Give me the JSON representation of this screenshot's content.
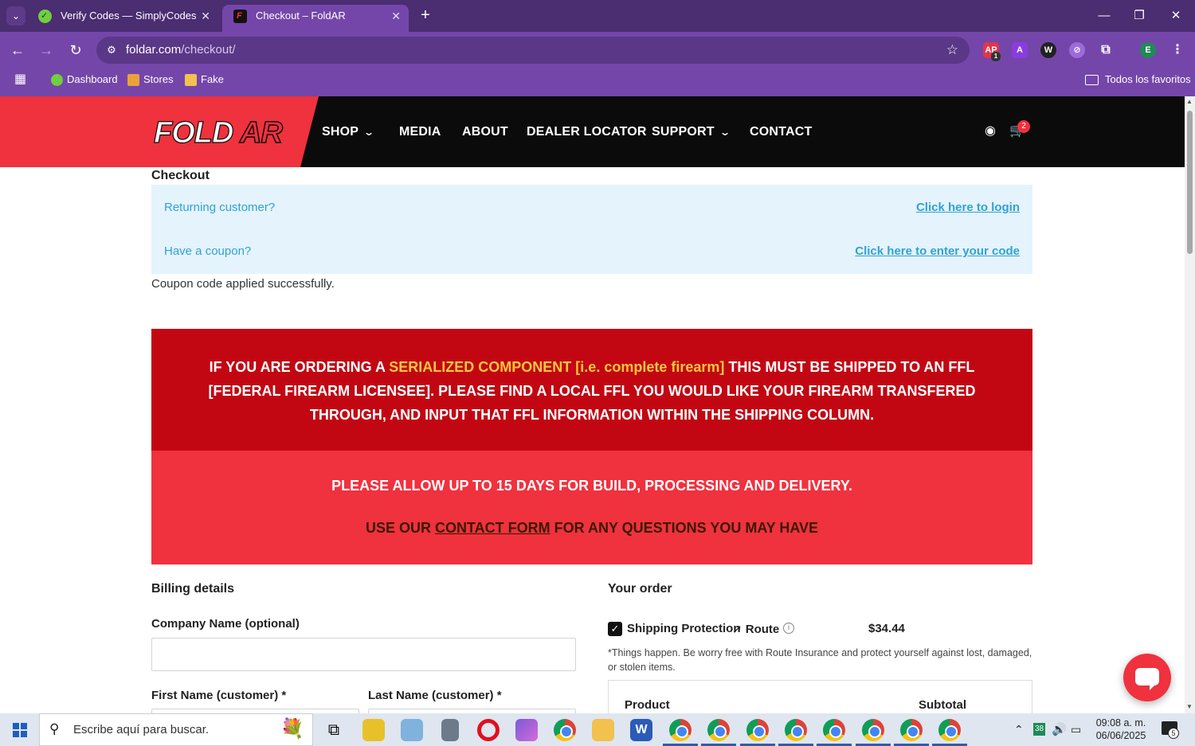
{
  "browser": {
    "tabs": [
      {
        "label": "Verify Codes — SimplyCodes",
        "active": false
      },
      {
        "label": "Checkout – FoldAR",
        "active": true
      }
    ],
    "url_host": "foldar.com",
    "url_path": "/checkout/",
    "bookmarks": [
      "Dashboard",
      "Stores",
      "Fake"
    ],
    "all_favorites": "Todos los favoritos",
    "profile_initial": "E",
    "ext_badge": "1",
    "accent": "#7446aa"
  },
  "site": {
    "logo_text": "FOLDAR",
    "nav": [
      "SHOP",
      "MEDIA",
      "ABOUT",
      "DEALER LOCATOR",
      "SUPPORT",
      "CONTACT"
    ],
    "cart_count": "2",
    "brand_red": "#f0313e",
    "dark_red": "#c20713"
  },
  "checkout": {
    "title": "Checkout",
    "returning": "Returning customer?",
    "login_link": "Click here to login",
    "coupon_q": "Have a coupon?",
    "coupon_link": "Click here to enter your code",
    "coupon_ok": "Coupon code applied successfully."
  },
  "banner": {
    "pre": "IF YOU ARE ORDERING A ",
    "highlight": "SERIALIZED COMPONENT [i.e. complete firearm]",
    "post": " THIS MUST BE SHIPPED TO AN FFL [FEDERAL FIREARM LICENSEE]. PLEASE FIND A LOCAL FFL YOU WOULD LIKE YOUR FIREARM TRANSFERED THROUGH, AND INPUT THAT FFL INFORMATION WITHIN THE SHIPPING COLUMN.",
    "allow": "PLEASE ALLOW UP TO 15 DAYS FOR BUILD, PROCESSING AND DELIVERY.",
    "use_pre": "USE OUR ",
    "use_link": "CONTACT FORM",
    "use_post": " FOR ANY QUESTIONS YOU MAY HAVE"
  },
  "billing": {
    "heading": "Billing details",
    "company_label": "Company Name (optional)",
    "company_value": "",
    "first_label": "First Name (customer) *",
    "last_label": "Last Name (customer) *"
  },
  "order": {
    "heading": "Your order",
    "shipping_label": "Shipping Protection",
    "route_label": "Route",
    "shipping_price": "$34.44",
    "shipping_checked": true,
    "route_note": "*Things happen. Be worry free with Route Insurance and protect yourself against lost, damaged, or stolen items.",
    "col_product": "Product",
    "col_subtotal": "Subtotal"
  },
  "taskbar": {
    "search_placeholder": "Escribe aquí para buscar.",
    "time": "09:08 a. m.",
    "date": "06/06/2025",
    "tray_num": "38",
    "notif_count": "5"
  }
}
